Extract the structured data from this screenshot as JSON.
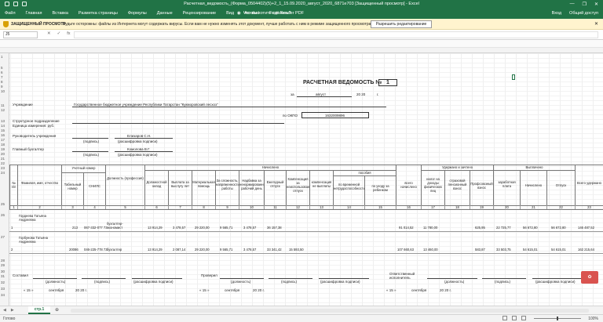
{
  "window": {
    "title": "Расчетная_ведомость_(Форма_0504402)(5)+2_1_15.09.2020_август_2020_6871е703 [Защищенный просмотр] - Excel",
    "minimize": "—",
    "restore": "❐",
    "close": "✕"
  },
  "ribbon": {
    "tabs": [
      "Файл",
      "Главная",
      "Вставка",
      "Разметка страницы",
      "Формулы",
      "Данные",
      "Рецензирование",
      "Вид",
      "Acrobat",
      "Foxit Reader PDF"
    ],
    "search_placeholder": "Что вы хотите сделать?",
    "sign_in": "Вход",
    "share": "Общий доступ"
  },
  "protected_view": {
    "label": "ЗАЩИЩЕННЫЙ ПРОСМОТР",
    "message": "Будьте осторожны: файлы из Интернета могут содержать вирусы. Если вам не нужно изменять этот документ, лучше работать с ним в режиме защищенного просмотра.",
    "button": "Разрешить редактирование"
  },
  "formula_bar": {
    "name_box": "J5",
    "fx": "fx"
  },
  "row_numbers": [
    "1",
    "5",
    "6",
    "7",
    "8",
    "9",
    "10",
    "11",
    "12",
    "13",
    "14",
    "15",
    "16",
    "17",
    "18",
    "19",
    "20",
    "21",
    "22",
    "23",
    "24",
    "25",
    "26",
    "27",
    "28",
    "29",
    "30",
    "31",
    "32",
    "33",
    "34"
  ],
  "form": {
    "title": "РАСЧЕТНАЯ ВЕДОМОСТЬ №",
    "number": "1",
    "date_prefix": "за",
    "month": "август",
    "year": "20  20",
    "year_suffix": "г.",
    "institution_label": "Учреждение",
    "institution_value": "Государственное бюджетное учреждение Республики Татарстан \"Кукморовский лесхоз\"",
    "okpo_label": "по ОКПО",
    "okpo_value": "1632009896",
    "division_label": "Структурное подразделение",
    "unit_label": "Единица измерения: руб.",
    "head_label": "Руководитель учреждения",
    "head_name": "Елизаров С.Н.",
    "head_sign": "(подпись)",
    "head_decode": "(расшифровка подписи)",
    "accountant_label": "Главный бухгалтер",
    "accountant_name": "Комолова В.Г.",
    "accountant_sign": "(подпись)",
    "accountant_decode": "(расшифровка подписи)"
  },
  "table": {
    "headers": {
      "no": "№ п/п",
      "fio": "Фамилия, имя, отчество",
      "account_group": "Учетный номер",
      "tab": "Табельный номер",
      "snils": "СНИЛС",
      "position": "Должность (профессия)",
      "accrued": "Начислено",
      "salary": "Должностной оклад",
      "years_bonus": "Выплата за выслугу лет",
      "material_aid": "Материальная помощь",
      "complexity": "За сложность, напряженность работы",
      "bonus": "Надбавка за ненормированный рабочий день",
      "vacation": "Ежегодный отпуск",
      "compensation": "Компенсация за неиспользованный отпуск",
      "comp_not_vacation": "компенсация не выплаты",
      "incl": "пособия",
      "temp_disability": "по временной нетрудоспособности",
      "child_care": "по уходу за ребенком",
      "total_accrued": "всего начислено",
      "withheld": "Удержано и зачтено",
      "ndfl": "налог на доходы физических лиц",
      "insurance": "страховой пенсионный взнос",
      "union": "Профсоюзный взнос",
      "paid": "Выплачено",
      "wage": "заработная плата",
      "accrual": "Начислено",
      "otpusk": "Отпуск",
      "total_withheld": "Всего удержано"
    },
    "col_numbers": [
      "1",
      "2",
      "3",
      "4",
      "5",
      "6",
      "7",
      "8",
      "9",
      "10",
      "11",
      "12",
      "13",
      "14",
      "15",
      "16",
      "17",
      "18",
      "19",
      "20",
      "21",
      "22",
      "23"
    ],
    "rows": [
      {
        "no": "1",
        "fio": "Гордеева Татьяна Андреевна",
        "tab": "213",
        "snils": "067-332-077 73",
        "position": "бухгалтер-экономист",
        "salary": "13 914,29",
        "years": "3 478,57",
        "aid": "29 220,00",
        "complex": "9 565,71",
        "bonus": "3 478,57",
        "vacation": "36 157,38",
        "comp": "",
        "total": "91 014,52",
        "ndfl": "11 780,00",
        "union": "625,95",
        "wage": "22 725,77",
        "accrual": "56 672,80",
        "otpusk": "56 672,80",
        "total_withheld": "146 487,52"
      },
      {
        "no": "2",
        "fio": "Горбунова Татьяна Андреевна",
        "tab": "20086",
        "snils": "046-225-778 73",
        "position": "бухгалтер",
        "salary": "13 914,29",
        "years": "2 087,14",
        "aid": "29 220,00",
        "complex": "9 565,71",
        "bonus": "3 478,57",
        "vacation": "33 341,42",
        "comp": "15 593,50",
        "total": "107 660,63",
        "ndfl": "13 460,00",
        "union": "583,87",
        "wage": "33 503,75",
        "accrual": "54 615,01",
        "otpusk": "54 615,01",
        "total_withheld": "162 215,64"
      }
    ]
  },
  "signatures": {
    "compiled": "Составил",
    "checked": "Проверил",
    "executor": "Ответственный исполнитель",
    "position": "(должность)",
    "sign": "(подпись)",
    "decode": "(расшифровка подписи)",
    "date_day": "«   15   »",
    "date_month": "сентября",
    "date_year": "20  20   г."
  },
  "sheet_tab": "стр.1",
  "status": {
    "ready": "Готово",
    "zoom": "100%"
  },
  "colors": {
    "excel_green": "#217346",
    "protected_yellow": "#fff4ce"
  }
}
